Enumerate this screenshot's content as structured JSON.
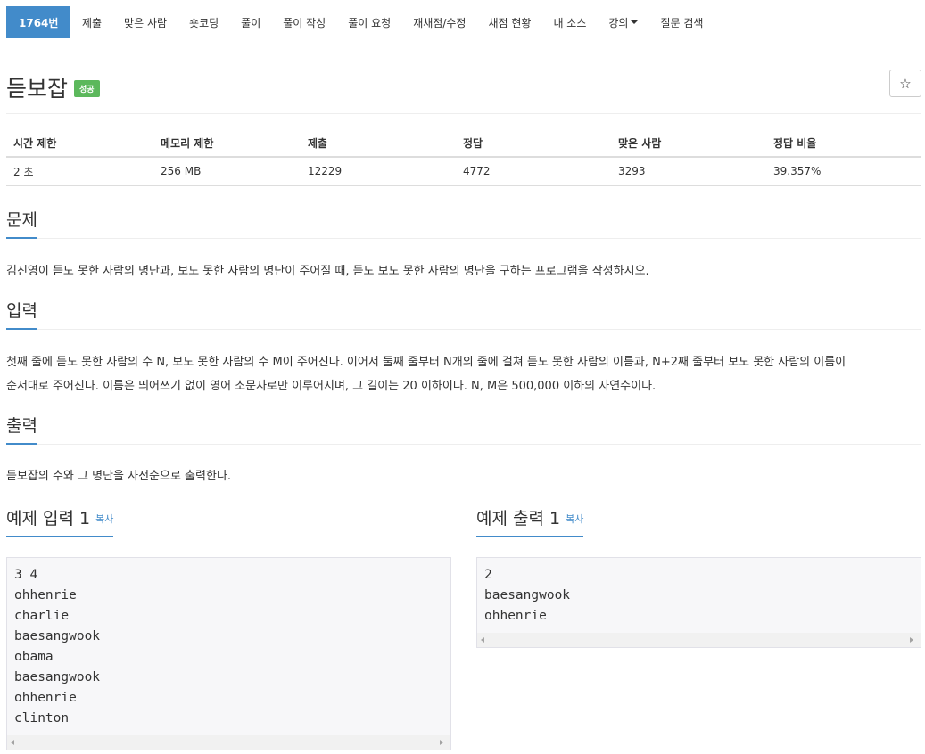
{
  "nav": {
    "items": [
      "1764번",
      "제출",
      "맞은 사람",
      "숏코딩",
      "풀이",
      "풀이 작성",
      "풀이 요청",
      "재채점/수정",
      "채점 현황",
      "내 소스",
      "강의",
      "질문 검색"
    ]
  },
  "problem": {
    "title": "듣보잡",
    "badge": "성공",
    "star": "☆"
  },
  "info": {
    "headers": [
      "시간 제한",
      "메모리 제한",
      "제출",
      "정답",
      "맞은 사람",
      "정답 비율"
    ],
    "values": [
      "2 초",
      "256 MB",
      "12229",
      "4772",
      "3293",
      "39.357%"
    ]
  },
  "sections": {
    "problem_title": "문제",
    "problem_text": "김진영이 듣도 못한 사람의 명단과, 보도 못한 사람의 명단이 주어질 때, 듣도 보도 못한 사람의 명단을 구하는 프로그램을 작성하시오.",
    "input_title": "입력",
    "input_text_1": "첫째 줄에 듣도 못한 사람의 수 N, 보도 못한 사람의 수 M이 주어진다. 이어서 둘째 줄부터 N개의 줄에 걸쳐 듣도 못한 사람의 이름과, N+2째 줄부터 보도 못한 사람의 이름이",
    "input_text_2": "순서대로 주어진다. 이름은 띄어쓰기 없이 영어 소문자로만 이루어지며, 그 길이는 20 이하이다. N, M은 500,000 이하의 자연수이다.",
    "output_title": "출력",
    "output_text": "듣보잡의 수와 그 명단을 사전순으로 출력한다."
  },
  "samples": {
    "input_title": "예제 입력 1",
    "output_title": "예제 출력 1",
    "copy_label": "복사",
    "input_lines": [
      "3 4",
      "ohhenrie",
      "charlie",
      "baesangwook",
      "obama",
      "baesangwook",
      "ohhenrie",
      "clinton"
    ],
    "output_lines": [
      "2",
      "baesangwook",
      "ohhenrie"
    ]
  }
}
